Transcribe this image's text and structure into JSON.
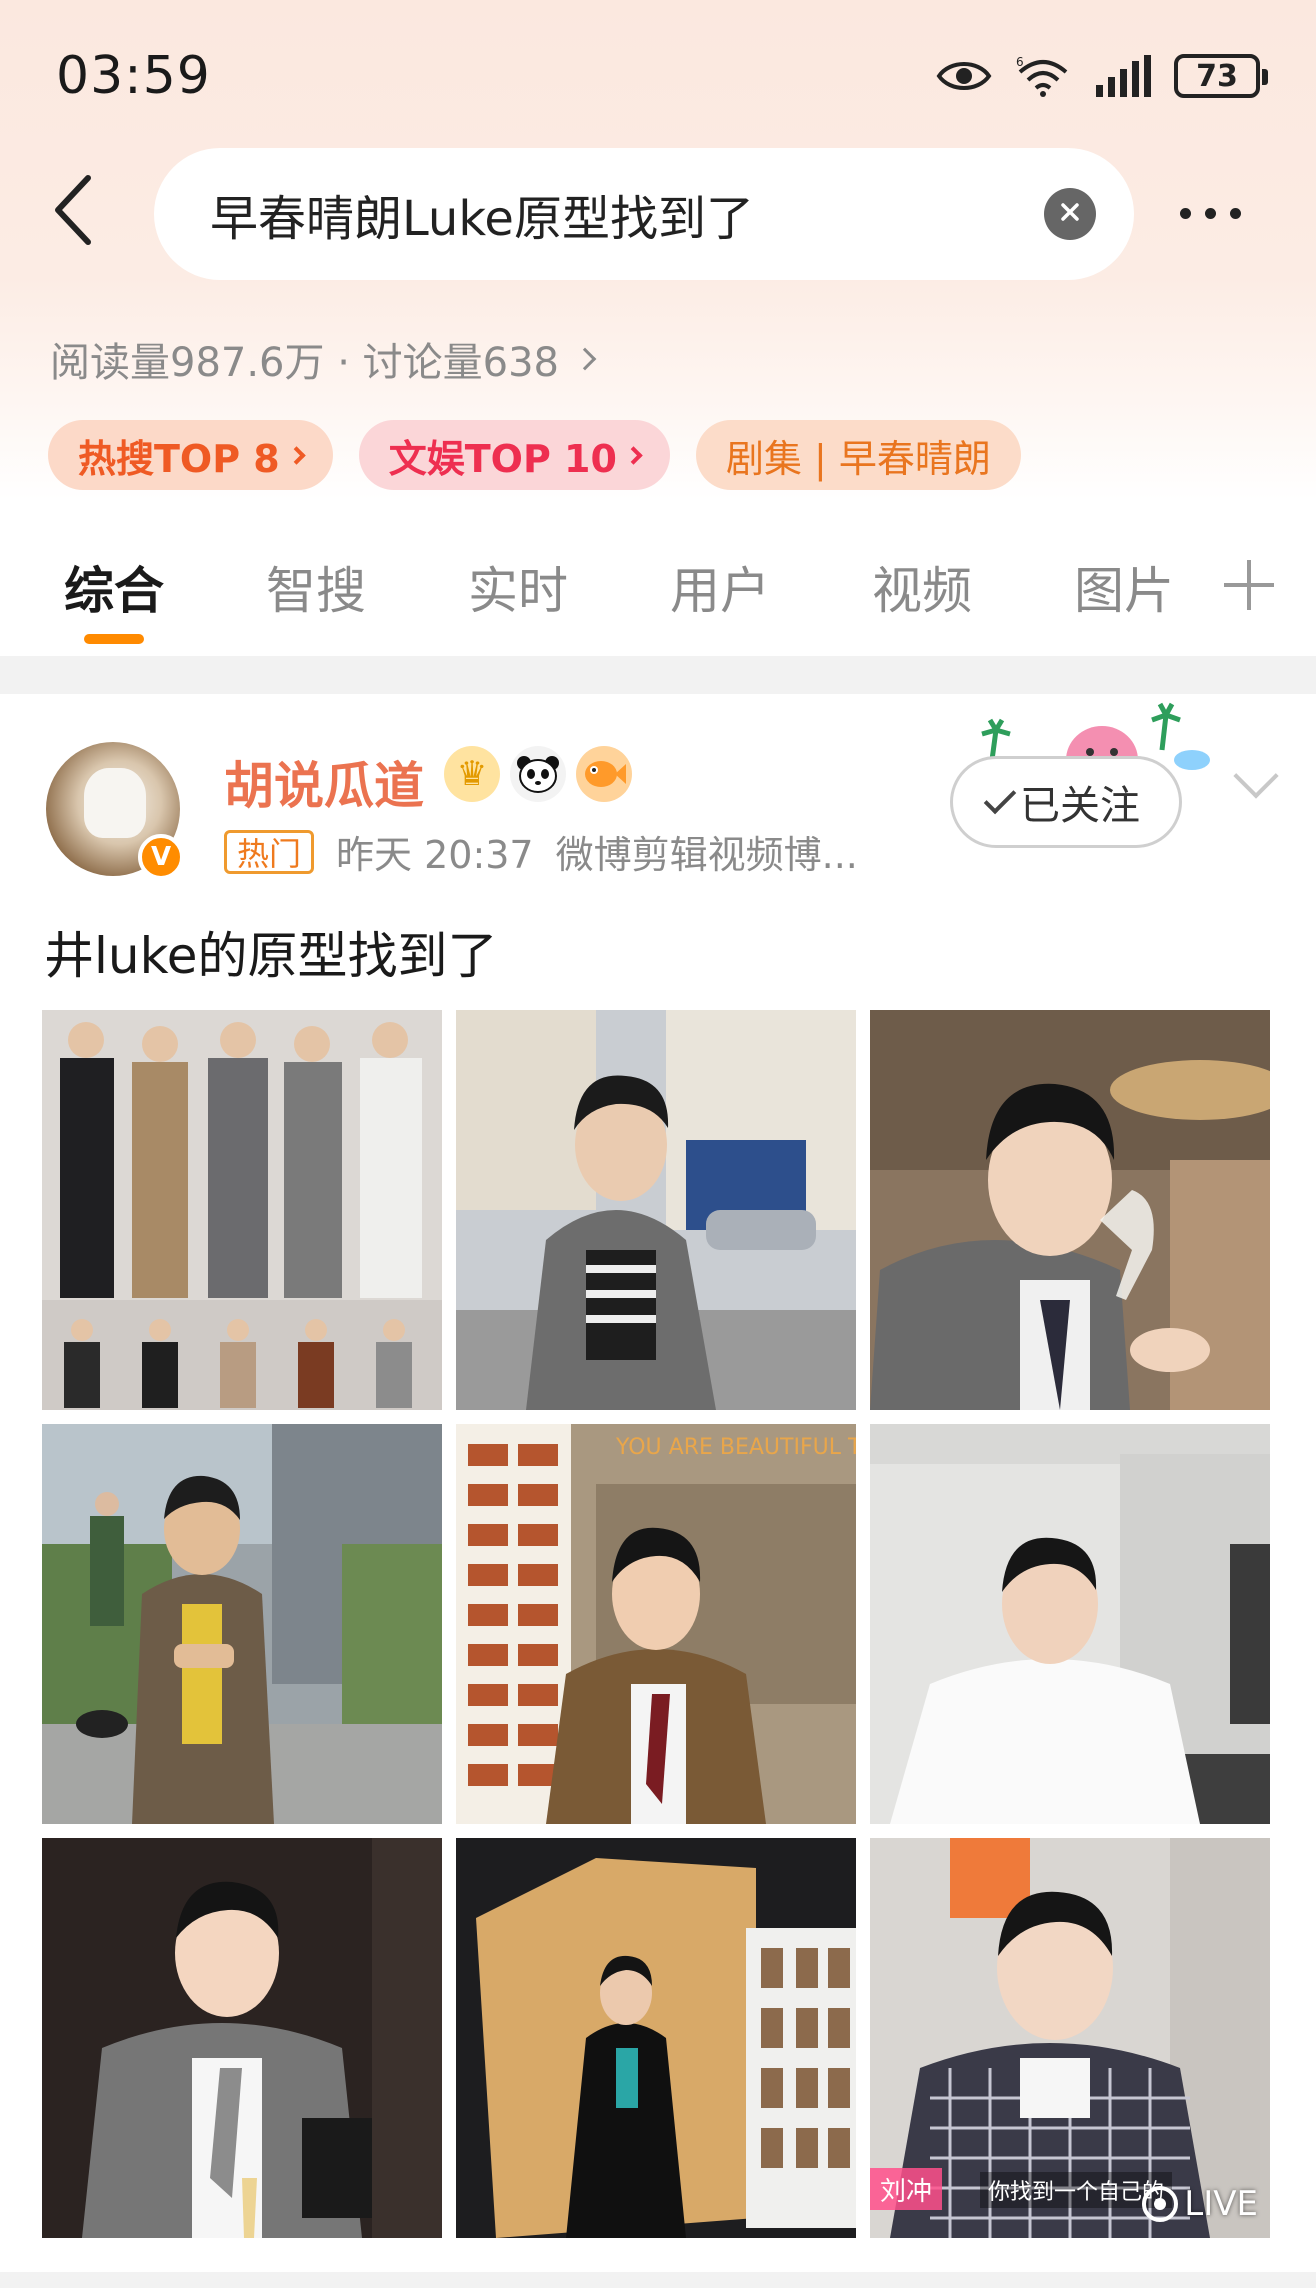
{
  "status": {
    "time": "03:59",
    "battery": "73",
    "icons": [
      "eye-icon",
      "wifi-6-icon",
      "signal-icon",
      "battery-icon"
    ]
  },
  "header": {
    "search_query": "早春晴朗Luke原型找到了",
    "icons": [
      "back-arrow-icon",
      "clear-icon",
      "more-icon"
    ]
  },
  "stats": {
    "text": "阅读量987.6万 · 讨论量638"
  },
  "tags": {
    "hot": "热搜TOP 8",
    "ent": "文娱TOP 10",
    "drama": "剧集 | 早春晴朗"
  },
  "tabs": [
    {
      "label": "综合",
      "active": true
    },
    {
      "label": "智搜"
    },
    {
      "label": "实时"
    },
    {
      "label": "用户"
    },
    {
      "label": "视频"
    },
    {
      "label": "图片"
    }
  ],
  "post": {
    "author": "胡说瓜道",
    "verified_badge": "V",
    "hot_label": "热门",
    "time": "昨天 20:37",
    "source": "微博剪辑视频博...",
    "follow_label": "已关注",
    "text": "井luke的原型找到了",
    "badge_icons": [
      "crown-icon",
      "panda-icon",
      "fish-icon"
    ],
    "image_captions": {
      "live_label": "LIVE",
      "name_tag": "刘冲",
      "subtitle": "你找到一个自己的"
    },
    "image_sign_text": "YOU ARE BEAUTIFUL TO"
  },
  "colors": {
    "accent": "#ff8a00",
    "author": "#eb7350",
    "hot_tag": "#ef5a24",
    "ent_tag": "#ee2f50"
  }
}
